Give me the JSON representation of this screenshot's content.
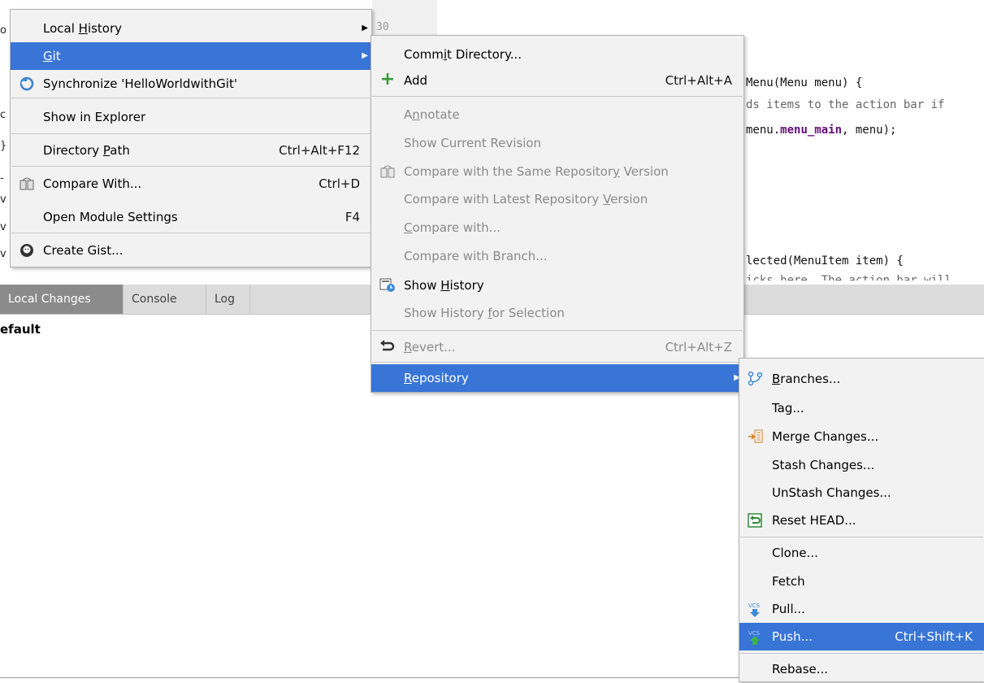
{
  "editor": {
    "gutter_number": "30",
    "line1": "Menu(Menu menu) {",
    "line2": "ds items to the action bar if",
    "line3_a": "menu.",
    "line3_b": "menu_main",
    "line3_c": ", menu);",
    "line4": "lected(MenuItem item) {",
    "line5": "icks here. The action bar will",
    "left_chars": [
      "o",
      "c",
      "}",
      "-",
      "v",
      "v",
      "v"
    ]
  },
  "tool_window": {
    "tabs": [
      "Local Changes",
      "Console",
      "Log"
    ],
    "active_tab": "Local Changes",
    "changelist_label": "efault"
  },
  "context_menu": {
    "items": [
      {
        "label": "Local History",
        "mnemonic": "H",
        "submenu": true
      },
      {
        "label": "Git",
        "mnemonic": "G",
        "submenu": true,
        "selected": true
      },
      {
        "label": "Synchronize 'HelloWorldwithGit'",
        "icon": "sync-icon"
      },
      {
        "label": "Show in Explorer"
      },
      {
        "label": "Directory Path",
        "shortcut": "Ctrl+Alt+F12"
      },
      {
        "label": "Compare With...",
        "shortcut": "Ctrl+D",
        "icon": "compare-icon"
      },
      {
        "label": "Open Module Settings",
        "shortcut": "F4"
      },
      {
        "label": "Create Gist...",
        "icon": "github-icon"
      }
    ]
  },
  "git_menu": {
    "items": [
      {
        "label": "Commit Directory..."
      },
      {
        "label": "Add",
        "shortcut": "Ctrl+Alt+A",
        "icon": "plus-icon"
      },
      {
        "label": "Annotate",
        "disabled": true
      },
      {
        "label": "Show Current Revision",
        "disabled": true
      },
      {
        "label": "Compare with the Same Repository Version",
        "disabled": true,
        "icon": "compare-icon"
      },
      {
        "label": "Compare with Latest Repository Version",
        "disabled": true
      },
      {
        "label": "Compare with...",
        "disabled": true
      },
      {
        "label": "Compare with Branch...",
        "disabled": true
      },
      {
        "label": "Show History",
        "icon": "history-icon"
      },
      {
        "label": "Show History for Selection",
        "disabled": true
      },
      {
        "label": "Revert...",
        "shortcut": "Ctrl+Alt+Z",
        "disabled": true,
        "icon": "revert-icon"
      },
      {
        "label": "Repository",
        "submenu": true,
        "selected": true
      }
    ]
  },
  "repository_menu": {
    "items": [
      {
        "label": "Branches...",
        "icon": "branch-icon"
      },
      {
        "label": "Tag..."
      },
      {
        "label": "Merge Changes...",
        "icon": "merge-icon"
      },
      {
        "label": "Stash Changes..."
      },
      {
        "label": "UnStash Changes..."
      },
      {
        "label": "Reset HEAD...",
        "icon": "reset-icon"
      },
      {
        "label": "Clone..."
      },
      {
        "label": "Fetch"
      },
      {
        "label": "Pull...",
        "icon": "vcs-pull-icon"
      },
      {
        "label": "Push...",
        "shortcut": "Ctrl+Shift+K",
        "selected": true,
        "icon": "vcs-push-icon"
      },
      {
        "label": "Rebase..."
      }
    ]
  },
  "colors": {
    "selection": "#3875d7",
    "menu_bg": "#f2f2f2",
    "disabled_text": "#8a8a8a",
    "add_icon": "#3a9a3a"
  }
}
